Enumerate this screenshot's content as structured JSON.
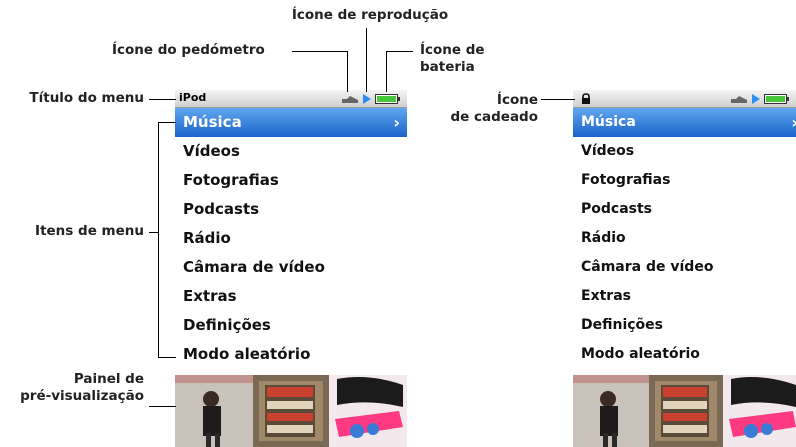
{
  "callouts": {
    "playback_icon": "Ícone de reprodução",
    "pedometer_icon": "Ícone do pedómetro",
    "battery_icon_line1": "Ícone de",
    "battery_icon_line2": "bateria",
    "menu_title": "Título do menu",
    "menu_items": "Itens de menu",
    "preview_panel_line1": "Painel de",
    "preview_panel_line2": "pré-visualização",
    "lock_icon_line1": "Ícone",
    "lock_icon_line2": "de cadeado"
  },
  "screen_left": {
    "title": "iPod",
    "menu": [
      "Música",
      "Vídeos",
      "Fotografias",
      "Podcasts",
      "Rádio",
      "Câmara de vídeo",
      "Extras",
      "Definições",
      "Modo aleatório"
    ],
    "selected_index": 0,
    "chevron": "›"
  },
  "screen_right": {
    "menu": [
      "Música",
      "Vídeos",
      "Fotografias",
      "Podcasts",
      "Rádio",
      "Câmara de vídeo",
      "Extras",
      "Definições",
      "Modo aleatório"
    ],
    "selected_index": 0,
    "chevron": "›"
  },
  "icons": [
    "pedometer-icon",
    "play-icon",
    "battery-icon",
    "lock-icon",
    "chevron-right-icon"
  ],
  "colors": {
    "selection_top": "#5fa7f0",
    "selection_bottom": "#1c62c9",
    "play_icon": "#2f8df0",
    "battery_fill": "#48c83a"
  }
}
